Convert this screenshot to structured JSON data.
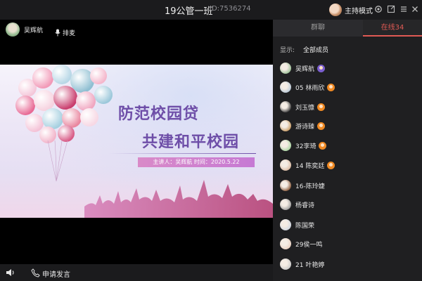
{
  "window": {
    "title": "19公管一班",
    "room_id": "ID:7536274",
    "host_mode": "主持模式"
  },
  "video": {
    "presenter_name": "吴辉航",
    "queue_label": "排麦",
    "slide": {
      "title_line1": "防范校园贷",
      "title_line2": "共建和平校园",
      "subtitle": "主讲人：吴辉航  时间：2020.5.22"
    }
  },
  "bottombar": {
    "request_label": "申请发言"
  },
  "panel": {
    "tabs": [
      {
        "label": "群聊"
      },
      {
        "label": "在线34"
      }
    ],
    "filter_label": "显示:",
    "filter_value": "全部成员",
    "members": [
      {
        "name": "吴辉航",
        "badge": "purple"
      },
      {
        "name": "05 林雨欣",
        "badge": "orange"
      },
      {
        "name": "刘玉慷",
        "badge": "orange"
      },
      {
        "name": "游诗臻",
        "badge": "orange"
      },
      {
        "name": "32李琦",
        "badge": "orange"
      },
      {
        "name": "14 陈奕廷",
        "badge": "orange"
      },
      {
        "name": "16-陈玲婕",
        "badge": ""
      },
      {
        "name": "杨睿诗",
        "badge": ""
      },
      {
        "name": "陈国荣",
        "badge": ""
      },
      {
        "name": "29侯一鸣",
        "badge": ""
      },
      {
        "name": "21 叶艳婷",
        "badge": ""
      }
    ]
  },
  "colors": {
    "accent": "#e05a54",
    "slide_title": "#6e4ea8"
  }
}
